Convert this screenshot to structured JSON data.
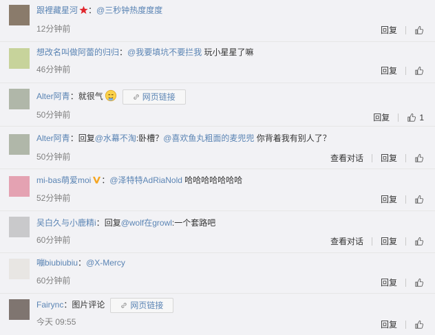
{
  "comments": [
    {
      "user": "跟裡藏星河",
      "colon": "：",
      "mention": "@三秒钟热度度度",
      "text": "",
      "time": "12分钟前",
      "reply": "回复",
      "avatar_color": "#8a7b6b"
    },
    {
      "user": "想改名叫做阿蕾的归归",
      "colon": "：",
      "mention": "@我要填坑不要拦我",
      "text": " 玩小星星了嘛",
      "time": "46分钟前",
      "reply": "回复",
      "avatar_color": "#c7d39b"
    },
    {
      "user": "Alter阿青",
      "colon": "：",
      "text": "就很气",
      "link_label": "网页链接",
      "time": "50分钟前",
      "reply": "回复",
      "likes": "1",
      "avatar_color": "#b0b7a9"
    },
    {
      "user": "Alter阿青",
      "colon": "：",
      "prefix": "回复",
      "mention": "@水幕不淘",
      "mid": ":卧槽？",
      "mention2": "@喜欢鱼丸粗面的麦兜兜",
      "text": " 你背着我有别人了？",
      "time": "50分钟前",
      "view_conv": "查看对话",
      "reply": "回复",
      "avatar_color": "#b0b7a9"
    },
    {
      "user": "mi-bas萌爱moi",
      "colon": "：",
      "mention": "@泽特特AdRiaNold",
      "text": " 哈哈哈哈哈哈哈",
      "time": "52分钟前",
      "reply": "回复",
      "avatar_color": "#e4a2b2"
    },
    {
      "user": "吴白久与小鹿精i",
      "colon": "：",
      "prefix": "回复",
      "mention": "@wolf在growl",
      "text": ":一个套路吧",
      "time": "60分钟前",
      "view_conv": "查看对话",
      "reply": "回复",
      "avatar_color": "#c9c9cb"
    },
    {
      "user": "嘣biubiubiu",
      "colon": "：",
      "mention": "@X-Mercy",
      "text": "",
      "time": "60分钟前",
      "reply": "回复",
      "avatar_color": "#e8e6e3"
    },
    {
      "user": "Fairync",
      "colon": "：",
      "text": "图片评论",
      "link_label": "网页链接",
      "time": "今天 09:55",
      "reply": "回复",
      "avatar_color": "#7f7570"
    }
  ],
  "colors": {
    "link": "#5a84b4",
    "star": "#e0262d",
    "vbadge": "#f5a623"
  }
}
